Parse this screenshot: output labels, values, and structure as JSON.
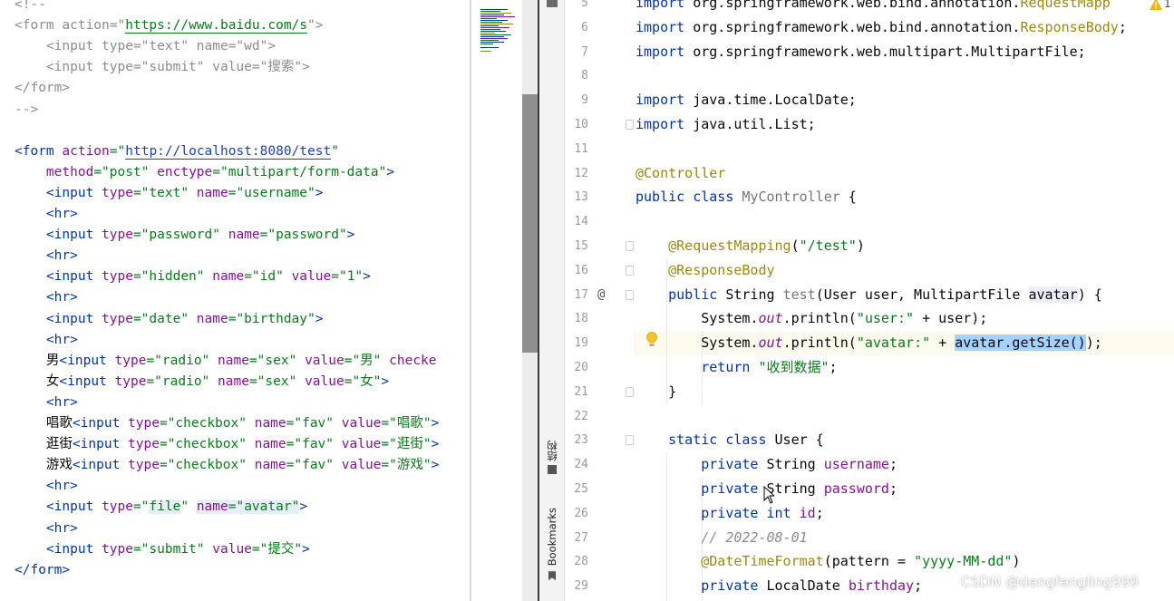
{
  "left_editor": {
    "lines": [
      [
        {
          "t": "<!--",
          "c": "t-com"
        }
      ],
      [
        {
          "t": "<form ",
          "c": "t-com"
        },
        {
          "t": "action=\"",
          "c": "t-com"
        },
        {
          "t": "https://www.baidu.com/s",
          "c": "url-green"
        },
        {
          "t": "\">",
          "c": "t-com"
        }
      ],
      [
        {
          "t": "    <input type=\"text\" name=\"wd\">",
          "c": "t-com"
        }
      ],
      [
        {
          "t": "    <input type=\"submit\" value=\"搜索\">",
          "c": "t-com"
        }
      ],
      [
        {
          "t": "</form>",
          "c": "t-com"
        }
      ],
      [
        {
          "t": "-->",
          "c": "t-com"
        }
      ],
      [
        {
          "t": "",
          "c": "t-plain"
        }
      ],
      [
        {
          "t": "<form ",
          "c": "t-tag"
        },
        {
          "t": "action",
          "c": "t-attr2"
        },
        {
          "t": "=\"",
          "c": "t-str"
        },
        {
          "t": "http://localhost:8080/test",
          "c": "url-blue"
        },
        {
          "t": "\"",
          "c": "t-str"
        }
      ],
      [
        {
          "t": "    ",
          "c": "t-plain"
        },
        {
          "t": "method",
          "c": "t-attr2"
        },
        {
          "t": "=\"post\" ",
          "c": "t-str"
        },
        {
          "t": "enctype",
          "c": "t-attr2"
        },
        {
          "t": "=\"multipart/form-data\"",
          "c": "t-str"
        },
        {
          "t": ">",
          "c": "t-tag"
        }
      ],
      [
        {
          "t": "    <input ",
          "c": "t-tag"
        },
        {
          "t": "type",
          "c": "t-attr2"
        },
        {
          "t": "=\"text\" ",
          "c": "t-str"
        },
        {
          "t": "name",
          "c": "t-attr2"
        },
        {
          "t": "=\"username\"",
          "c": "t-str"
        },
        {
          "t": ">",
          "c": "t-tag"
        }
      ],
      [
        {
          "t": "    <hr>",
          "c": "t-tag"
        }
      ],
      [
        {
          "t": "    <input ",
          "c": "t-tag"
        },
        {
          "t": "type",
          "c": "t-attr2"
        },
        {
          "t": "=\"password\" ",
          "c": "t-str"
        },
        {
          "t": "name",
          "c": "t-attr2"
        },
        {
          "t": "=\"password\"",
          "c": "t-str"
        },
        {
          "t": ">",
          "c": "t-tag"
        }
      ],
      [
        {
          "t": "    <hr>",
          "c": "t-tag"
        }
      ],
      [
        {
          "t": "    <input ",
          "c": "t-tag"
        },
        {
          "t": "type",
          "c": "t-attr2"
        },
        {
          "t": "=\"hidden\" ",
          "c": "t-str"
        },
        {
          "t": "name",
          "c": "t-attr2"
        },
        {
          "t": "=\"id\" ",
          "c": "t-str"
        },
        {
          "t": "value",
          "c": "t-attr2"
        },
        {
          "t": "=\"1\"",
          "c": "t-str"
        },
        {
          "t": ">",
          "c": "t-tag"
        }
      ],
      [
        {
          "t": "    <hr>",
          "c": "t-tag"
        }
      ],
      [
        {
          "t": "    <input ",
          "c": "t-tag"
        },
        {
          "t": "type",
          "c": "t-attr2"
        },
        {
          "t": "=\"date\" ",
          "c": "t-str"
        },
        {
          "t": "name",
          "c": "t-attr2"
        },
        {
          "t": "=\"birthday\"",
          "c": "t-str"
        },
        {
          "t": ">",
          "c": "t-tag"
        }
      ],
      [
        {
          "t": "    <hr>",
          "c": "t-tag"
        }
      ],
      [
        {
          "t": "    男",
          "c": "t-plain"
        },
        {
          "t": "<input ",
          "c": "t-tag"
        },
        {
          "t": "type",
          "c": "t-attr2"
        },
        {
          "t": "=\"radio\" ",
          "c": "t-str"
        },
        {
          "t": "name",
          "c": "t-attr2"
        },
        {
          "t": "=\"sex\" ",
          "c": "t-str"
        },
        {
          "t": "value",
          "c": "t-attr2"
        },
        {
          "t": "=\"男\" ",
          "c": "t-str"
        },
        {
          "t": "checke",
          "c": "t-attr2"
        }
      ],
      [
        {
          "t": "    女",
          "c": "t-plain"
        },
        {
          "t": "<input ",
          "c": "t-tag"
        },
        {
          "t": "type",
          "c": "t-attr2"
        },
        {
          "t": "=\"radio\" ",
          "c": "t-str"
        },
        {
          "t": "name",
          "c": "t-attr2"
        },
        {
          "t": "=\"sex\" ",
          "c": "t-str"
        },
        {
          "t": "value",
          "c": "t-attr2"
        },
        {
          "t": "=\"女\"",
          "c": "t-str"
        },
        {
          "t": ">",
          "c": "t-tag"
        }
      ],
      [
        {
          "t": "    <hr>",
          "c": "t-tag"
        }
      ],
      [
        {
          "t": "    唱歌",
          "c": "t-plain"
        },
        {
          "t": "<input ",
          "c": "t-tag"
        },
        {
          "t": "type",
          "c": "t-attr2"
        },
        {
          "t": "=\"checkbox\" ",
          "c": "t-str"
        },
        {
          "t": "name",
          "c": "t-attr2"
        },
        {
          "t": "=\"fav\" ",
          "c": "t-str"
        },
        {
          "t": "value",
          "c": "t-attr2"
        },
        {
          "t": "=\"唱歌\"",
          "c": "t-str"
        },
        {
          "t": ">",
          "c": "t-tag"
        }
      ],
      [
        {
          "t": "    逛街",
          "c": "t-plain"
        },
        {
          "t": "<input ",
          "c": "t-tag"
        },
        {
          "t": "type",
          "c": "t-attr2"
        },
        {
          "t": "=\"checkbox\" ",
          "c": "t-str"
        },
        {
          "t": "name",
          "c": "t-attr2"
        },
        {
          "t": "=\"fav\" ",
          "c": "t-str"
        },
        {
          "t": "value",
          "c": "t-attr2"
        },
        {
          "t": "=\"逛街\"",
          "c": "t-str"
        },
        {
          "t": ">",
          "c": "t-tag"
        }
      ],
      [
        {
          "t": "    游戏",
          "c": "t-plain"
        },
        {
          "t": "<input ",
          "c": "t-tag"
        },
        {
          "t": "type",
          "c": "t-attr2"
        },
        {
          "t": "=\"checkbox\" ",
          "c": "t-str"
        },
        {
          "t": "name",
          "c": "t-attr2"
        },
        {
          "t": "=\"fav\" ",
          "c": "t-str"
        },
        {
          "t": "value",
          "c": "t-attr2"
        },
        {
          "t": "=\"游戏\"",
          "c": "t-str"
        },
        {
          "t": ">",
          "c": "t-tag"
        }
      ],
      [
        {
          "t": "    <hr>",
          "c": "t-tag"
        }
      ],
      [
        {
          "t": "    <input ",
          "c": "t-tag"
        },
        {
          "t": "type",
          "c": "t-attr2"
        },
        {
          "t": "=\"",
          "c": "t-str"
        },
        {
          "t": "file",
          "c": "t-str hl-file"
        },
        {
          "t": "\" ",
          "c": "t-str"
        },
        {
          "t": "name",
          "c": "t-attr2 hl-file"
        },
        {
          "t": "=\"avatar\"",
          "c": "t-str hl-file"
        },
        {
          "t": ">",
          "c": "t-tag"
        }
      ],
      [
        {
          "t": "    <hr>",
          "c": "t-tag"
        }
      ],
      [
        {
          "t": "    <input ",
          "c": "t-tag"
        },
        {
          "t": "type",
          "c": "t-attr2"
        },
        {
          "t": "=\"submit\" ",
          "c": "t-str"
        },
        {
          "t": "value",
          "c": "t-attr2"
        },
        {
          "t": "=\"提交\"",
          "c": "t-str"
        },
        {
          "t": ">",
          "c": "t-tag"
        }
      ],
      [
        {
          "t": "</form>",
          "c": "t-tag"
        }
      ]
    ]
  },
  "ide": {
    "tool_tabs": {
      "structure": "结构",
      "bookmarks": "Bookmarks"
    },
    "warning_count": "1",
    "rows": [
      {
        "n": "5",
        "tokens": [
          {
            "t": "import ",
            "c": "k-kw"
          },
          {
            "t": "org.springframework.web.bind.annotation.",
            "c": ""
          },
          {
            "t": "RequestMapp",
            "c": "k-ann"
          }
        ]
      },
      {
        "n": "6",
        "tokens": [
          {
            "t": "import ",
            "c": "k-kw"
          },
          {
            "t": "org.springframework.web.bind.annotation.",
            "c": ""
          },
          {
            "t": "ResponseBody",
            "c": "k-ann"
          },
          {
            "t": ";",
            "c": ""
          }
        ]
      },
      {
        "n": "7",
        "tokens": [
          {
            "t": "import ",
            "c": "k-kw"
          },
          {
            "t": "org.springframework.web.multipart.MultipartFile;",
            "c": ""
          }
        ]
      },
      {
        "n": "8",
        "tokens": []
      },
      {
        "n": "9",
        "tokens": [
          {
            "t": "import ",
            "c": "k-kw"
          },
          {
            "t": "java.time.LocalDate;",
            "c": ""
          }
        ]
      },
      {
        "n": "10",
        "tokens": [
          {
            "t": "import ",
            "c": "k-kw"
          },
          {
            "t": "java.util.List;",
            "c": ""
          }
        ]
      },
      {
        "n": "11",
        "tokens": []
      },
      {
        "n": "12",
        "tokens": [
          {
            "t": "@Controller",
            "c": "k-ann"
          }
        ]
      },
      {
        "n": "13",
        "tokens": [
          {
            "t": "public class ",
            "c": "k-kw"
          },
          {
            "t": "MyController",
            "c": "k-gray"
          },
          {
            "t": " {",
            "c": ""
          }
        ]
      },
      {
        "n": "14",
        "tokens": []
      },
      {
        "n": "15",
        "tokens": [
          {
            "t": "    ",
            "c": ""
          },
          {
            "t": "@RequestMapping",
            "c": "k-ann"
          },
          {
            "t": "(",
            "c": ""
          },
          {
            "t": "\"/test\"",
            "c": "k-str"
          },
          {
            "t": ")",
            "c": ""
          }
        ]
      },
      {
        "n": "16",
        "tokens": [
          {
            "t": "    ",
            "c": ""
          },
          {
            "t": "@ResponseBody",
            "c": "k-ann"
          }
        ]
      },
      {
        "n": "17",
        "tokens": [
          {
            "t": "    ",
            "c": ""
          },
          {
            "t": "public ",
            "c": "k-kw"
          },
          {
            "t": "String ",
            "c": ""
          },
          {
            "t": "test",
            "c": "k-gray"
          },
          {
            "t": "(User user, MultipartFile ",
            "c": ""
          },
          {
            "t": "avatar",
            "c": "k-param"
          },
          {
            "t": ") {",
            "c": ""
          }
        ]
      },
      {
        "n": "18",
        "tokens": [
          {
            "t": "        System.",
            "c": ""
          },
          {
            "t": "out",
            "c": "k-field k-ital"
          },
          {
            "t": ".println(",
            "c": ""
          },
          {
            "t": "\"user:\"",
            "c": "k-str"
          },
          {
            "t": " + user);",
            "c": ""
          }
        ]
      },
      {
        "n": "19",
        "tokens": [
          {
            "t": "        System.",
            "c": ""
          },
          {
            "t": "out",
            "c": "k-field k-ital"
          },
          {
            "t": ".println(",
            "c": ""
          },
          {
            "t": "\"avatar:\"",
            "c": "k-str"
          },
          {
            "t": " + ",
            "c": ""
          },
          {
            "t": "avatar.getSize()",
            "c": "sel"
          },
          {
            "t": ");",
            "c": ""
          }
        ]
      },
      {
        "n": "20",
        "tokens": [
          {
            "t": "        ",
            "c": ""
          },
          {
            "t": "return ",
            "c": "k-kw"
          },
          {
            "t": "\"收到数据\"",
            "c": "k-str"
          },
          {
            "t": ";",
            "c": ""
          }
        ]
      },
      {
        "n": "21",
        "tokens": [
          {
            "t": "    }",
            "c": ""
          }
        ]
      },
      {
        "n": "22",
        "tokens": []
      },
      {
        "n": "23",
        "tokens": [
          {
            "t": "    ",
            "c": ""
          },
          {
            "t": "static class ",
            "c": "k-kw"
          },
          {
            "t": "User {",
            "c": ""
          }
        ]
      },
      {
        "n": "24",
        "tokens": [
          {
            "t": "        ",
            "c": ""
          },
          {
            "t": "private ",
            "c": "k-kw"
          },
          {
            "t": "String ",
            "c": ""
          },
          {
            "t": "username",
            "c": "k-field"
          },
          {
            "t": ";",
            "c": ""
          }
        ]
      },
      {
        "n": "25",
        "tokens": [
          {
            "t": "        ",
            "c": ""
          },
          {
            "t": "private ",
            "c": "k-kw"
          },
          {
            "t": "String ",
            "c": ""
          },
          {
            "t": "password",
            "c": "k-field"
          },
          {
            "t": ";",
            "c": ""
          }
        ]
      },
      {
        "n": "26",
        "tokens": [
          {
            "t": "        ",
            "c": ""
          },
          {
            "t": "private int ",
            "c": "k-kw"
          },
          {
            "t": "id",
            "c": "k-field"
          },
          {
            "t": ";",
            "c": ""
          }
        ]
      },
      {
        "n": "27",
        "tokens": [
          {
            "t": "        ",
            "c": ""
          },
          {
            "t": "// 2022-08-01",
            "c": "k-com"
          }
        ]
      },
      {
        "n": "28",
        "tokens": [
          {
            "t": "        ",
            "c": ""
          },
          {
            "t": "@DateTimeFormat",
            "c": "k-ann"
          },
          {
            "t": "(pattern = ",
            "c": ""
          },
          {
            "t": "\"yyyy-MM-dd\"",
            "c": "k-str"
          },
          {
            "t": ")",
            "c": ""
          }
        ]
      },
      {
        "n": "29",
        "tokens": [
          {
            "t": "        ",
            "c": ""
          },
          {
            "t": "private ",
            "c": "k-kw"
          },
          {
            "t": "LocalDate ",
            "c": ""
          },
          {
            "t": "birthday",
            "c": "k-field"
          },
          {
            "t": ";",
            "c": ""
          }
        ]
      }
    ]
  },
  "watermark": "CSDN @dengfengling999",
  "colors": {
    "keyword": "#0033b3",
    "annotation": "#9e880d",
    "string": "#067d17",
    "field": "#871094",
    "selection": "#a6d2ff"
  }
}
